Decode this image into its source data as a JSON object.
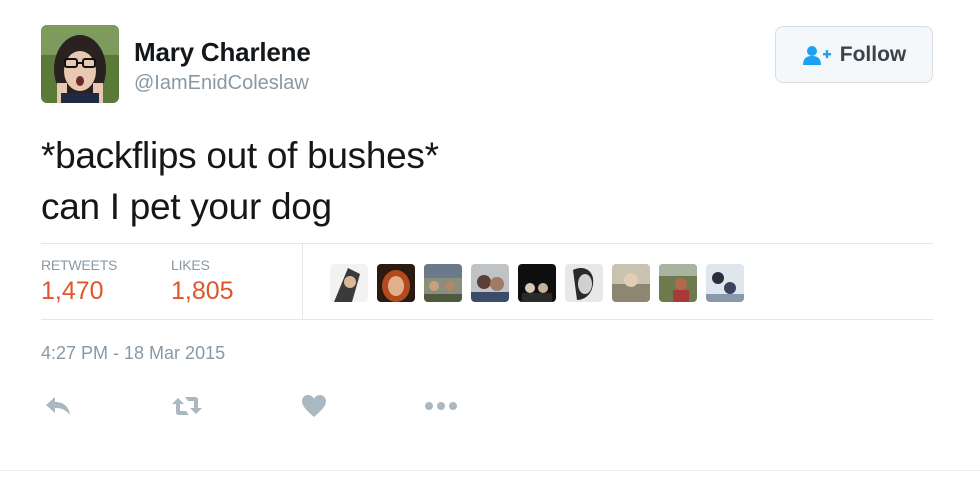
{
  "user": {
    "display_name": "Mary Charlene",
    "handle": "@IamEnidColeslaw"
  },
  "follow_button": {
    "label": "Follow",
    "icon": "add-person-icon",
    "accent": "#1da1f2"
  },
  "tweet": {
    "lines": [
      "*backflips out of bushes*",
      "can I pet your dog"
    ]
  },
  "stats": {
    "retweets_label": "RETWEETS",
    "retweets_value": "1,470",
    "likes_label": "LIKES",
    "likes_value": "1,805",
    "value_color": "#e0552d"
  },
  "likers": [
    {
      "name": "liker-avatar-1"
    },
    {
      "name": "liker-avatar-2"
    },
    {
      "name": "liker-avatar-3"
    },
    {
      "name": "liker-avatar-4"
    },
    {
      "name": "liker-avatar-5"
    },
    {
      "name": "liker-avatar-6"
    },
    {
      "name": "liker-avatar-7"
    },
    {
      "name": "liker-avatar-8"
    },
    {
      "name": "liker-avatar-9"
    }
  ],
  "timestamp": "4:27 PM - 18 Mar 2015",
  "actions": [
    {
      "icon": "reply-icon"
    },
    {
      "icon": "retweet-icon"
    },
    {
      "icon": "heart-icon"
    },
    {
      "icon": "more-icon"
    }
  ]
}
